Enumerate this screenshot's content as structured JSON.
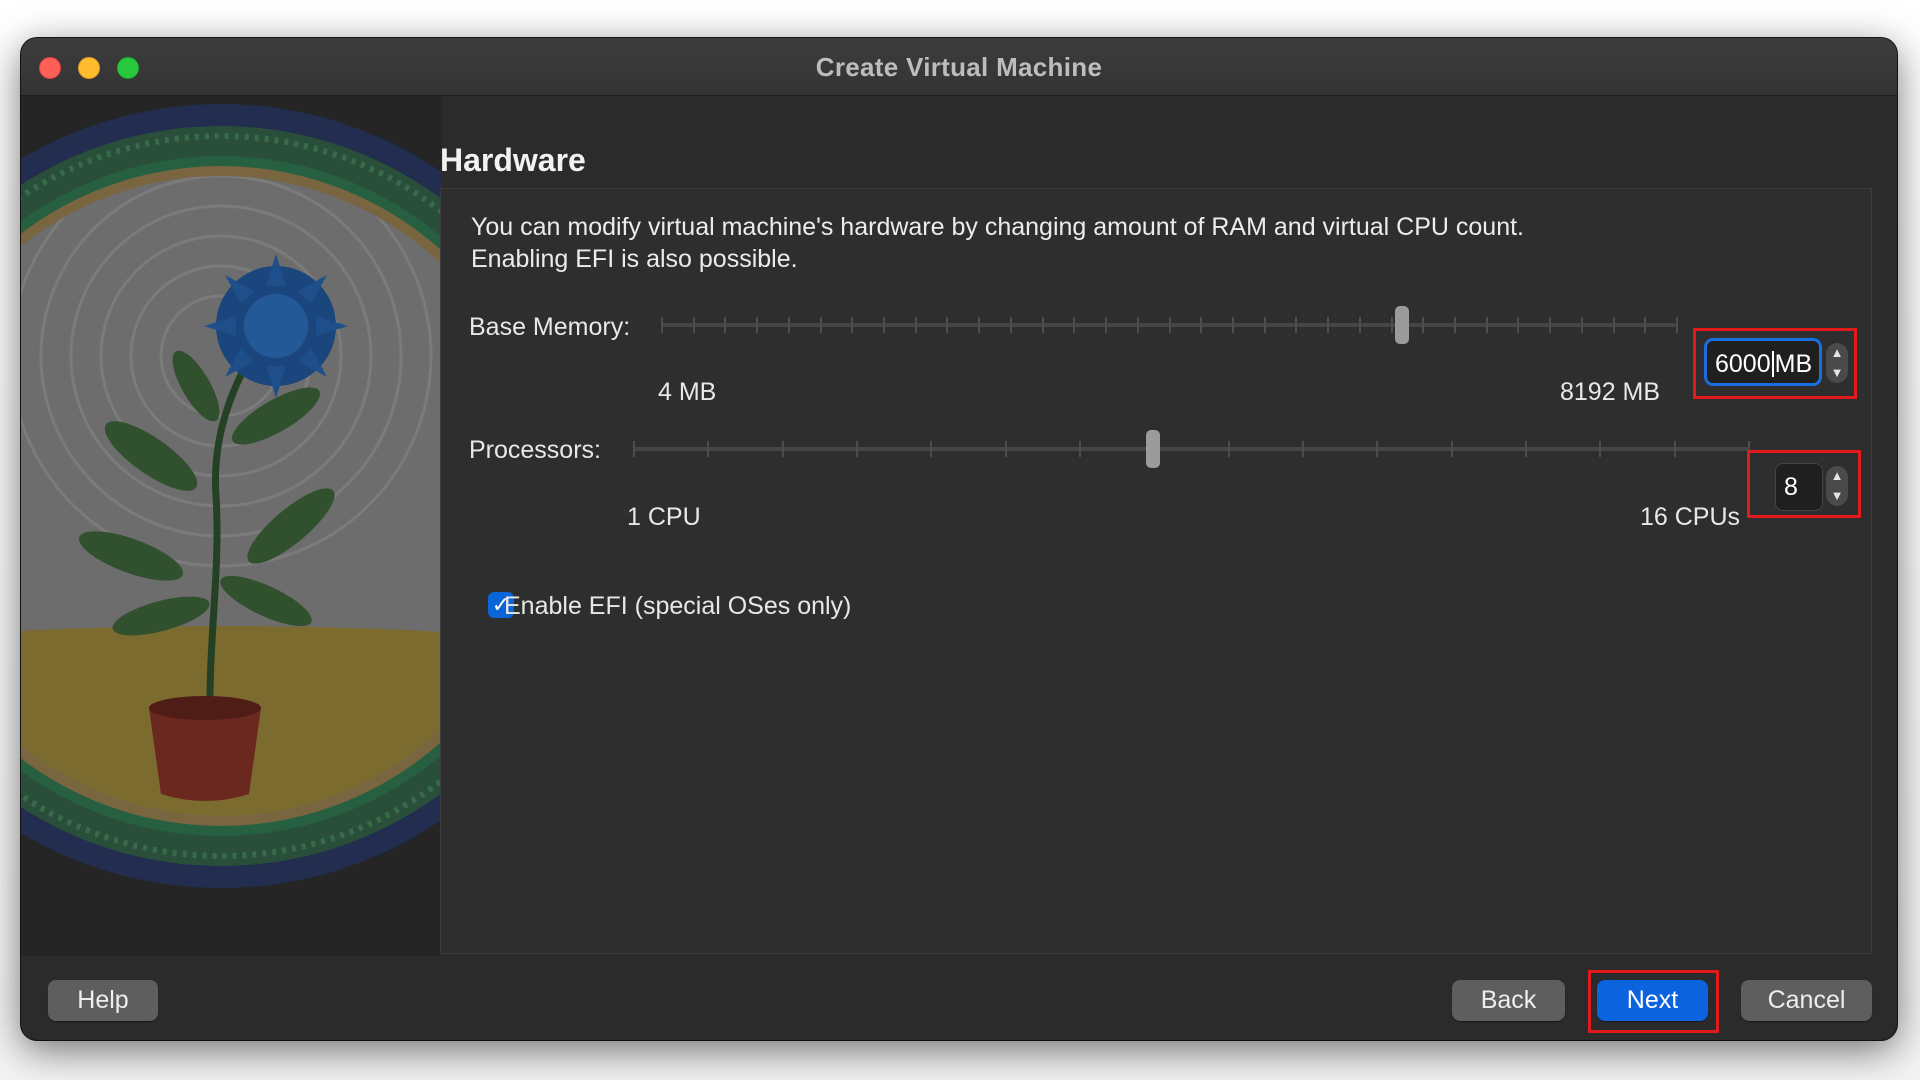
{
  "window": {
    "title": "Create Virtual Machine"
  },
  "page": {
    "heading": "Hardware",
    "description_line1": "You can modify virtual machine's hardware by changing amount of RAM and virtual CPU count.",
    "description_line2": "Enabling EFI is also possible."
  },
  "memory": {
    "label": "Base Memory:",
    "min_label": "4 MB",
    "max_label": "8192 MB",
    "value": "6000",
    "unit": "MB",
    "min": 4,
    "max": 8192,
    "current": 6000,
    "slider_fraction": 0.73
  },
  "processors": {
    "label": "Processors:",
    "min_label": "1 CPU",
    "max_label": "16 CPUs",
    "value": "8",
    "min": 1,
    "max": 16,
    "current": 8
  },
  "efi": {
    "label": "Enable EFI (special OSes only)",
    "checked": true
  },
  "buttons": {
    "help": "Help",
    "back": "Back",
    "next": "Next",
    "cancel": "Cancel"
  },
  "icons": {
    "step_up": "chevron-up-icon",
    "step_down": "chevron-down-icon",
    "check": "checkmark-icon"
  },
  "colors": {
    "accent": "#0b63dd",
    "highlight": "#e11b1b",
    "window_bg": "#2b2b2b"
  }
}
